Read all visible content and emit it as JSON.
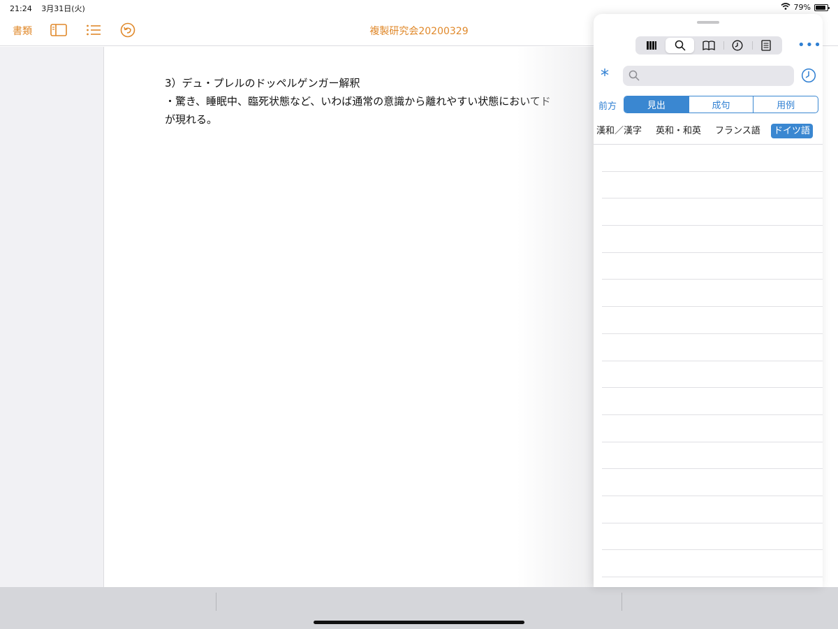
{
  "status_bar": {
    "time": "21:24",
    "date": "3月31日(火)",
    "battery_percent": "79%",
    "battery_level": 0.79
  },
  "toolbar": {
    "documents_label": "書類",
    "title": "複製研究会20200329",
    "icons": [
      "sidebar-icon",
      "list-icon",
      "undo-icon"
    ]
  },
  "document": {
    "lines": [
      "3）デュ・プレルのドッペルゲンガー解釈",
      "・驚き、睡眠中、臨死状態など、いわば通常の意識から離れやすい状態においてド",
      "が現れる。"
    ]
  },
  "dictionary_panel": {
    "tool_tabs": [
      "bookshelf-icon",
      "search-icon",
      "book-icon",
      "history-icon",
      "notes-icon"
    ],
    "active_tool": 1,
    "more_label": "•••",
    "wildcard_symbol": "*",
    "search": {
      "value": "",
      "placeholder": ""
    },
    "match_mode_label": "前方",
    "search_modes": [
      "見出",
      "成句",
      "用例"
    ],
    "active_search_mode": 0,
    "dictionaries": [
      "漢和／漢字",
      "英和・和英",
      "フランス語",
      "ドイツ語"
    ],
    "active_dictionary": 3
  },
  "colors": {
    "accent_orange": "#e0892b",
    "accent_blue": "#3a87d1"
  }
}
